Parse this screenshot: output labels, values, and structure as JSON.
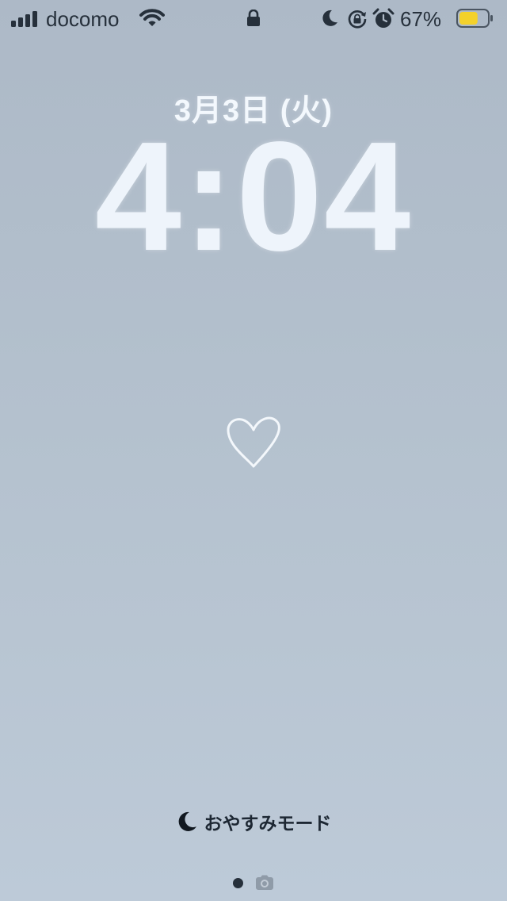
{
  "status_bar": {
    "carrier": "docomo",
    "battery_percent": "67%",
    "battery_level": 0.67,
    "battery_color": "#f3d12b",
    "icons": [
      "signal-icon",
      "wifi-icon",
      "lock-icon",
      "moon-icon",
      "rotation-lock-icon",
      "alarm-icon",
      "battery-icon"
    ]
  },
  "lock_screen": {
    "date": "3月3日 (火)",
    "time": "4:04",
    "widget_icon": "heart-icon"
  },
  "focus": {
    "label": "おやすみモード",
    "icon": "moon-icon"
  },
  "pager": {
    "icons": [
      "page-dot",
      "camera-icon"
    ]
  },
  "colors": {
    "background_top": "#adb9c7",
    "background_bottom": "#bdcad8",
    "clock_text": "#eef4fb",
    "status_text": "#26303b"
  }
}
